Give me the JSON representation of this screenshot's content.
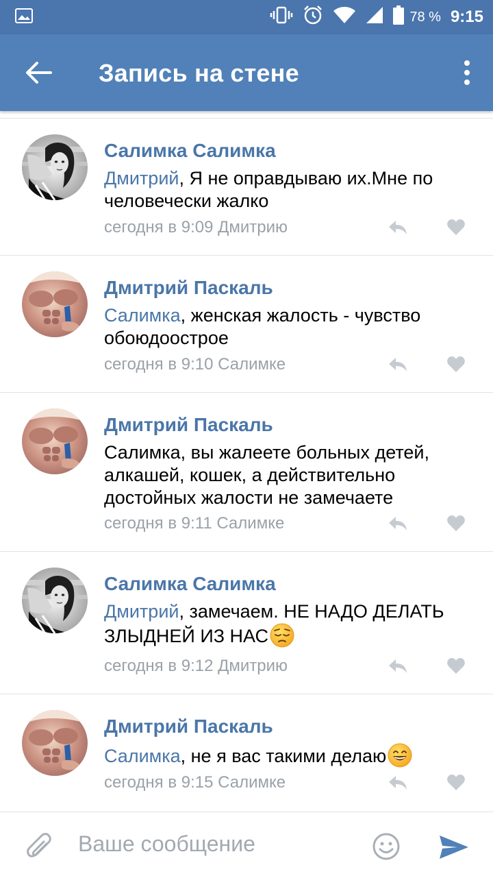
{
  "status_bar": {
    "battery": "78 %",
    "time": "9:15"
  },
  "app_bar": {
    "title": "Запись на стене"
  },
  "comments": [
    {
      "author": "Салимка Салимка",
      "mention": "Дмитрий",
      "text": ", Я не оправдываю их.Мне по человечески жалко",
      "meta": "сегодня в 9:09 Дмитрию",
      "avatar": "woman-bw-photo"
    },
    {
      "author": "Дмитрий Паскаль",
      "mention": "Салимка",
      "text": ", женская жалость - чувство обоюдоострое",
      "meta": "сегодня в 9:10 Салимке",
      "avatar": "man-torso-photo"
    },
    {
      "author": "Дмитрий Паскаль",
      "mention": "",
      "text": "Салимка, вы жалеете больных детей, алкашей, кошек, а действительно достойных жалости не замечаете",
      "meta": "сегодня в 9:11 Салимке",
      "avatar": "man-torso-photo"
    },
    {
      "author": "Салимка Салимка",
      "mention": "Дмитрий",
      "text": ", замечаем. НЕ НАДО ДЕЛАТЬ ЗЛЫДНЕЙ ИЗ НАС",
      "meta": "сегодня в 9:12 Дмитрию",
      "avatar": "woman-bw-photo",
      "emoji": "pensive-face"
    },
    {
      "author": "Дмитрий Паскаль",
      "mention": "Салимка",
      "text": ", не я вас такими делаю",
      "meta": "сегодня в 9:15 Салимке",
      "avatar": "man-torso-photo",
      "emoji": "grinning-face"
    }
  ],
  "composer": {
    "placeholder": "Ваше сообщение"
  },
  "colors": {
    "app_bar": "#5181b8",
    "status_bar": "#4a75ad",
    "link": "#4a76a8",
    "meta": "#9aa1a8"
  }
}
